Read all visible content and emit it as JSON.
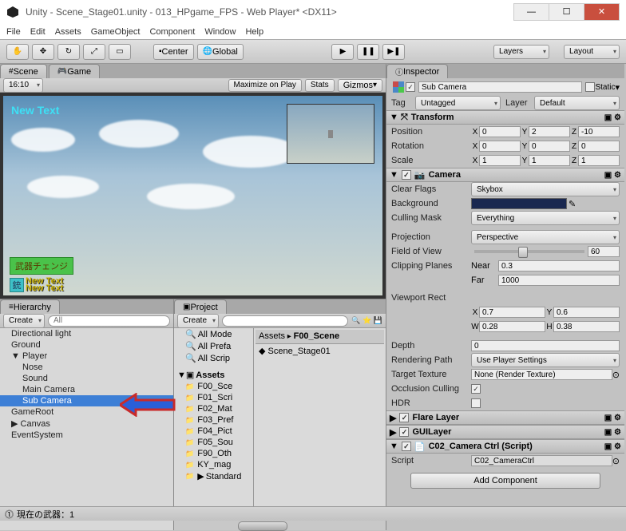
{
  "window": {
    "title": "Unity - Scene_Stage01.unity - 013_HPgame_FPS - Web Player* <DX11>",
    "min": "—",
    "max": "☐",
    "close": "✕"
  },
  "menu": [
    "File",
    "Edit",
    "Assets",
    "GameObject",
    "Component",
    "Window",
    "Help"
  ],
  "toolbar": {
    "center": "Center",
    "global": "Global",
    "layers": "Layers",
    "layout": "Layout"
  },
  "sceneTabs": {
    "scene": "Scene",
    "game": "Game"
  },
  "gamebar": {
    "aspect": "16:10",
    "maxOnPlay": "Maximize on Play",
    "stats": "Stats",
    "gizmos": "Gizmos"
  },
  "gameview": {
    "newText": "New Text",
    "badge1": "武器チェンジ",
    "badge2sq": "銃",
    "badge2tx1": "New Text",
    "badge2tx2": "New Text"
  },
  "hierarchy": {
    "title": "Hierarchy",
    "create": "Create",
    "allSearch": "All",
    "items": [
      "Directional light",
      "Ground",
      "Player",
      "Nose",
      "Sound",
      "Main Camera",
      "Sub Camera",
      "GameRoot",
      "Canvas",
      "EventSystem"
    ]
  },
  "project": {
    "title": "Project",
    "create": "Create",
    "favs": [
      "All Mode",
      "All Prefa",
      "All Scrip"
    ],
    "assets": "Assets",
    "folders": [
      "F00_Sce",
      "F01_Scri",
      "F02_Mat",
      "F03_Pref",
      "F04_Pict",
      "F05_Sou",
      "F90_Oth",
      "KY_mag",
      "Standard"
    ],
    "crumb1": "Assets",
    "crumb2": "F00_Scene",
    "scene": "Scene_Stage01"
  },
  "inspector": {
    "title": "Inspector",
    "name": "Sub Camera",
    "static": "Static",
    "tag": "Tag",
    "tagv": "Untagged",
    "layer": "Layer",
    "layerv": "Default",
    "transform": "Transform",
    "pos": "Position",
    "px": "0",
    "py": "2",
    "pz": "-10",
    "rot": "Rotation",
    "rx": "0",
    "ry": "0",
    "rz": "0",
    "scl": "Scale",
    "sx": "1",
    "sy": "1",
    "sz": "1",
    "camera": "Camera",
    "clearFlags": "Clear Flags",
    "clearFlagsV": "Skybox",
    "background": "Background",
    "cullingMask": "Culling Mask",
    "cullingMaskV": "Everything",
    "projection": "Projection",
    "projectionV": "Perspective",
    "fov": "Field of View",
    "fovV": "60",
    "clipping": "Clipping Planes",
    "near": "Near",
    "nearV": "0.3",
    "far": "Far",
    "farV": "1000",
    "viewport": "Viewport Rect",
    "vx": "0.7",
    "vy": "0.6",
    "vw": "0.28",
    "vh": "0.38",
    "depth": "Depth",
    "depthV": "0",
    "renderPath": "Rendering Path",
    "renderPathV": "Use Player Settings",
    "targetTex": "Target Texture",
    "targetTexV": "None (Render Texture)",
    "occlusion": "Occlusion Culling",
    "hdr": "HDR",
    "flare": "Flare Layer",
    "guilayer": "GUILayer",
    "script": "C02_Camera Ctrl (Script)",
    "scriptLbl": "Script",
    "scriptV": "C02_CameraCtrl",
    "addComp": "Add Component"
  },
  "status": "現在の武器：1"
}
